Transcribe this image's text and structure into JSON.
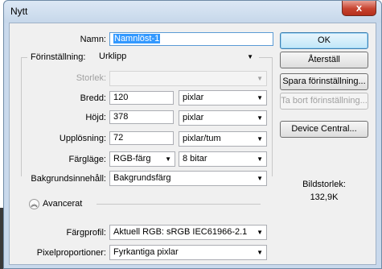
{
  "window": {
    "title": "Nytt",
    "close_glyph": "x"
  },
  "form": {
    "name": {
      "label": "Namn:",
      "value": "Namnlöst-1"
    },
    "preset": {
      "label": "Förinställning:",
      "value": "Urklipp"
    },
    "size": {
      "label": "Storlek:",
      "value": ""
    },
    "width": {
      "label": "Bredd:",
      "value": "120",
      "unit": "pixlar"
    },
    "height": {
      "label": "Höjd:",
      "value": "378",
      "unit": "pixlar"
    },
    "resolution": {
      "label": "Upplösning:",
      "value": "72",
      "unit": "pixlar/tum"
    },
    "color_mode": {
      "label": "Färgläge:",
      "value": "RGB-färg",
      "depth": "8 bitar"
    },
    "background": {
      "label": "Bakgrundsinnehåll:",
      "value": "Bakgrundsfärg"
    },
    "advanced": {
      "label": "Avancerat",
      "icon": "chevron-up-icon"
    },
    "color_profile": {
      "label": "Färgprofil:",
      "value": "Aktuell RGB:  sRGB IEC61966-2.1"
    },
    "pixel_aspect": {
      "label": "Pixelproportioner:",
      "value": "Fyrkantiga pixlar"
    }
  },
  "buttons": {
    "ok": "OK",
    "reset": "Återställ",
    "save_preset": "Spara förinställning...",
    "delete_preset": "Ta bort förinställning...",
    "device_central": "Device Central..."
  },
  "image_size": {
    "label": "Bildstorlek:",
    "value": "132,9K"
  }
}
